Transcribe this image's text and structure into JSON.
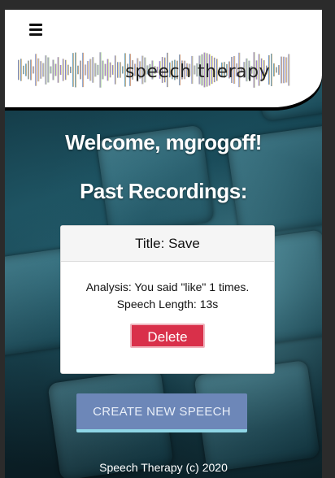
{
  "header": {
    "menu_icon": "hamburger-menu-icon",
    "logo_text": "speech therapy",
    "logo_colors": [
      "#555555",
      "#6f7ae0",
      "#58c7e0",
      "#f06ab0",
      "#f5e85c",
      "#8ad06c",
      "#999999"
    ]
  },
  "main": {
    "welcome": "Welcome, mgrogoff!",
    "past_heading": "Past Recordings:",
    "recordings": [
      {
        "title": "Title: Save",
        "analysis": "Analysis: You said \"like\" 1 times.",
        "length": "Speech Length: 13s",
        "delete_label": "Delete"
      }
    ],
    "create_label": "CREATE NEW SPEECH"
  },
  "footer": {
    "text": "Speech Therapy (c) 2020"
  },
  "colors": {
    "delete_button": "#d9304a",
    "create_button": "#6d87b8",
    "create_underline": "#8fd6e6"
  }
}
